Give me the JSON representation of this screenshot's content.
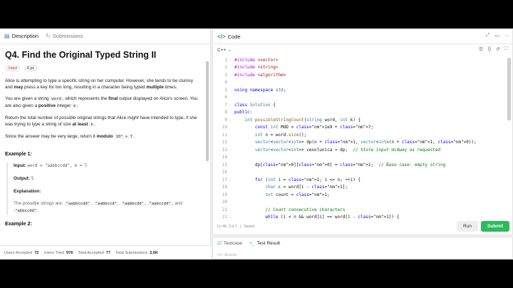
{
  "left_tabs": {
    "description": "Description",
    "submissions": "Submissions"
  },
  "problem": {
    "title": "Q4. Find the Original Typed String II",
    "difficulty": "Hard",
    "points": "6 pt.",
    "p1": {
      "a": "Alice is attempting to type a specific string on her computer. However, she tends to be clumsy and ",
      "b1": "may",
      "c": " press a key for too long, resulting in a character being typed ",
      "b2": "multiple",
      "d": " times."
    },
    "p2": {
      "a": "You are given a string ",
      "code1": "word",
      "b": ", which represents the ",
      "b1": "final",
      "c": " output displayed on Alice's screen. You are also given a ",
      "b2": "positive",
      "d": " integer ",
      "code2": "k",
      "e": "."
    },
    "p3": {
      "a": "Return the total number of ",
      "i1": "possible",
      "b": " original strings that Alice ",
      "i2": "might",
      "c": " have intended to type, if she was trying to type a string of size ",
      "b1": "at least",
      "d": " ",
      "code1": "k",
      "e": "."
    },
    "p4": {
      "a": "Since the answer may be very large, return it ",
      "b1": "modulo",
      "c": " ",
      "code1": "10⁹ + 7",
      "d": "."
    },
    "example1": {
      "title": "Example 1:",
      "input_label": "Input:",
      "input_value": "word = \"aabbccdd\", k = 7",
      "output_label": "Output:",
      "output_value": "5",
      "explanation_label": "Explanation:",
      "explanation_text": "The possible strings are: ",
      "strings": [
        "\"aabbccdd\"",
        "\"aabbccd\"",
        "\"aabbcdd\"",
        "\"aabccdd\"",
        "\"abbccdd\""
      ],
      "sep": ", ",
      "and": ", and "
    },
    "example2_title": "Example 2:"
  },
  "stats": [
    {
      "label": "Users Accepted",
      "value": "72"
    },
    {
      "label": "Users Tried",
      "value": "976"
    },
    {
      "label": "Total Accepted",
      "value": "77"
    },
    {
      "label": "Total Submissions",
      "value": "2.6K"
    }
  ],
  "editor": {
    "header": "Code",
    "language": "C++",
    "status_position": "Ln 45, Col 1",
    "status_saved": "Saved",
    "run_label": "Run",
    "submit_label": "Submit"
  },
  "code_lines": [
    {
      "n": "1",
      "t": "#include <vector>"
    },
    {
      "n": "2",
      "t": "#include <string>"
    },
    {
      "n": "3",
      "t": "#include <algorithm>"
    },
    {
      "n": "4",
      "t": ""
    },
    {
      "n": "5",
      "t": "using namespace std;"
    },
    {
      "n": "6",
      "t": ""
    },
    {
      "n": "7",
      "t": "class Solution {",
      "fold": true
    },
    {
      "n": "8",
      "t": "public:"
    },
    {
      "n": "9",
      "t": "    int possibleStringCount(string word, int k) {",
      "fold": true
    },
    {
      "n": "10",
      "t": "        const int MOD = 1e9 + 7;"
    },
    {
      "n": "11",
      "t": "        int n = word.size();"
    },
    {
      "n": "12",
      "t": "        vector<vector<int>> dp(n + 1, vector<int>(n + 1, 0));"
    },
    {
      "n": "13",
      "t": "        vector<vector<int>> vexolunica = dp;  // Store input midway as requested"
    },
    {
      "n": "14",
      "t": ""
    },
    {
      "n": "15",
      "t": "        dp[0][0] = 1;  // Base case: empty string"
    },
    {
      "n": "16",
      "t": ""
    },
    {
      "n": "17",
      "t": "        for (int i = 1; i <= n; ++i) {",
      "fold": true
    },
    {
      "n": "18",
      "t": "            char c = word[i - 1];"
    },
    {
      "n": "19",
      "t": "            int count = 1;"
    },
    {
      "n": "20",
      "t": ""
    },
    {
      "n": "21",
      "t": "            // Count consecutive characters"
    },
    {
      "n": "22",
      "t": "            while (i < n && word[i] == word[i - 1]) {",
      "fold": true
    },
    {
      "n": "23",
      "t": "                ++count;"
    },
    {
      "n": "24",
      "t": "                ++i;"
    },
    {
      "n": "25",
      "t": "            }"
    }
  ],
  "test": {
    "testcase": "Testcase",
    "result": "Test Result",
    "source": "Source"
  }
}
